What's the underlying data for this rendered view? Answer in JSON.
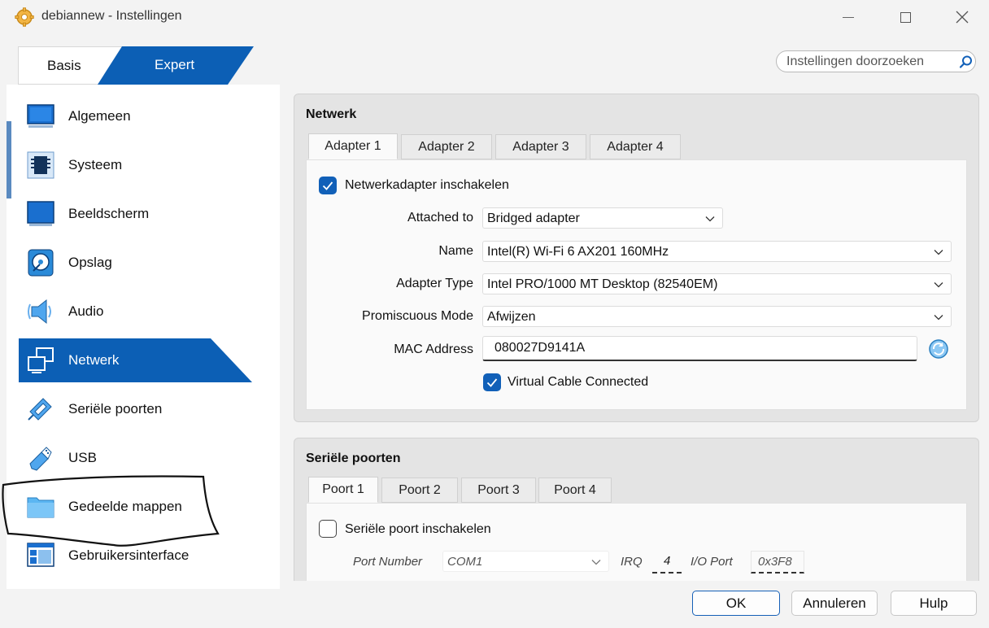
{
  "window": {
    "title": "debiannew - Instellingen",
    "controls": [
      "minimize-icon",
      "maximize-icon",
      "close-icon"
    ]
  },
  "mode": {
    "basis_label": "Basis",
    "expert_label": "Expert",
    "selected": "Expert"
  },
  "search": {
    "placeholder": "Instellingen doorzoeken"
  },
  "sidebar": {
    "items": [
      {
        "label": "Algemeen",
        "icon": "general-monitor-icon"
      },
      {
        "label": "Systeem",
        "icon": "system-chip-icon"
      },
      {
        "label": "Beeldscherm",
        "icon": "display-icon"
      },
      {
        "label": "Opslag",
        "icon": "storage-disk-icon"
      },
      {
        "label": "Audio",
        "icon": "audio-speaker-icon"
      },
      {
        "label": "Netwerk",
        "icon": "network-icon"
      },
      {
        "label": "Seriële poorten",
        "icon": "serial-port-icon"
      },
      {
        "label": "USB",
        "icon": "usb-icon"
      },
      {
        "label": "Gedeelde mappen",
        "icon": "shared-folder-icon"
      },
      {
        "label": "Gebruikersinterface",
        "icon": "user-interface-icon"
      }
    ],
    "selected": "Netwerk"
  },
  "network": {
    "title": "Netwerk",
    "tabs": [
      "Adapter 1",
      "Adapter 2",
      "Adapter 3",
      "Adapter 4"
    ],
    "active_tab": "Adapter 1",
    "enable_label": "Netwerkadapter inschakelen",
    "enable_checked": true,
    "fields": {
      "attached_to_label": "Attached to",
      "attached_to_value": "Bridged adapter",
      "name_label": "Name",
      "name_value": "Intel(R) Wi-Fi 6 AX201 160MHz",
      "adapter_type_label": "Adapter Type",
      "adapter_type_value": "Intel PRO/1000 MT Desktop (82540EM)",
      "promiscuous_label": "Promiscuous Mode",
      "promiscuous_value": "Afwijzen",
      "mac_label": "MAC Address",
      "mac_value": "080027D9141A"
    },
    "cable_label": "Virtual Cable Connected",
    "cable_checked": true
  },
  "serial": {
    "title": "Seriële poorten",
    "tabs": [
      "Poort 1",
      "Poort 2",
      "Poort 3",
      "Poort 4"
    ],
    "active_tab": "Poort 1",
    "enable_label": "Seriële poort inschakelen",
    "enable_checked": false,
    "port_number_label": "Port Number",
    "port_number_value": "COM1",
    "irq_label": "IRQ",
    "irq_value": "4",
    "io_port_label": "I/O Port",
    "io_port_value": "0x3F8"
  },
  "buttons": {
    "ok": "OK",
    "cancel": "Annuleren",
    "help": "Hulp"
  },
  "colors": {
    "accent": "#1160b8",
    "selected_nav": "#0c5fb5",
    "expert_tab": "#0c5fb5"
  }
}
